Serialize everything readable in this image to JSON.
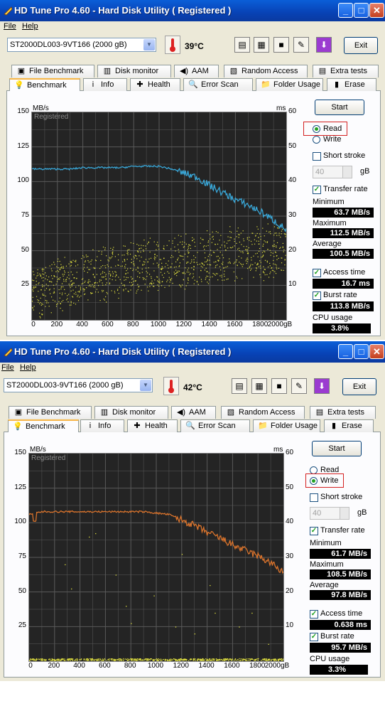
{
  "window_title": "HD Tune Pro 4.60 - Hard Disk Utility ( Registered )",
  "menu": {
    "file": "File",
    "help": "Help"
  },
  "toolbar": {
    "drive": "ST2000DL003-9VT166 (2000 gB)",
    "exit_label": "Exit"
  },
  "tabs_row1": [
    "File Benchmark",
    "Disk monitor",
    "AAM",
    "Random Access",
    "Extra tests"
  ],
  "tabs_row2": [
    "Benchmark",
    "Info",
    "Health",
    "Error Scan",
    "Folder Usage",
    "Erase"
  ],
  "graph": {
    "watermark": "Registered",
    "left_unit": "MB/s",
    "right_unit": "ms",
    "left_ticks": [
      "150",
      "125",
      "100",
      "75",
      "50",
      "25"
    ],
    "right_ticks": [
      "60",
      "50",
      "40",
      "30",
      "20",
      "10"
    ],
    "x_ticks": [
      "0",
      "200",
      "400",
      "600",
      "800",
      "1000",
      "1200",
      "1400",
      "1600",
      "1800",
      "2000gB"
    ]
  },
  "controls": {
    "start_label": "Start",
    "read_label": "Read",
    "write_label": "Write",
    "short_stroke_label": "Short stroke",
    "short_stroke_value": "40",
    "short_stroke_unit": "gB",
    "transfer_rate_label": "Transfer rate",
    "minimum_label": "Minimum",
    "maximum_label": "Maximum",
    "average_label": "Average",
    "access_time_label": "Access time",
    "burst_rate_label": "Burst rate",
    "cpu_usage_label": "CPU usage"
  },
  "colors": {
    "read_line": "#39a7d8",
    "write_line": "#d9732c",
    "access_dots": "#e0e040",
    "graph_bg": "#242424",
    "grid": "#5a5a5a"
  },
  "panels": [
    {
      "mode": "Read",
      "temperature": "39°C",
      "minimum": "63.7 MB/s",
      "maximum": "112.5 MB/s",
      "average": "100.5 MB/s",
      "access_time": "16.7 ms",
      "burst_rate": "113.8 MB/s",
      "cpu_usage": "3.8%",
      "chart_data": {
        "type": "line",
        "x": [
          0,
          100,
          200,
          300,
          400,
          500,
          600,
          700,
          800,
          900,
          1000,
          1100,
          1200,
          1300,
          1400,
          1500,
          1600,
          1700,
          1800,
          1900,
          2000
        ],
        "series": [
          {
            "values": [
              109,
              109,
              109,
              109,
              110,
              110,
              110,
              110,
              111,
              111,
              111,
              109,
              106,
              103,
              97,
              92,
              87,
              83,
              78,
              72,
              65
            ]
          }
        ],
        "access_time_range_ms": [
          6,
          26
        ],
        "ylim": [
          0,
          150
        ],
        "y2lim": [
          0,
          60
        ]
      }
    },
    {
      "mode": "Write",
      "temperature": "42°C",
      "minimum": "61.7 MB/s",
      "maximum": "108.5 MB/s",
      "average": "97.8 MB/s",
      "access_time": "0.638 ms",
      "burst_rate": "95.7 MB/s",
      "cpu_usage": "3.3%",
      "chart_data": {
        "type": "line",
        "x": [
          0,
          100,
          200,
          300,
          400,
          500,
          600,
          700,
          800,
          900,
          1000,
          1100,
          1200,
          1300,
          1400,
          1500,
          1600,
          1700,
          1800,
          1900,
          2000
        ],
        "series": [
          {
            "values": [
              106,
              108,
              108,
              108,
              108,
              108,
              108,
              108,
              108,
              108,
              107,
              106,
              102,
              98,
              93,
              89,
              84,
              80,
              76,
              71,
              64
            ]
          }
        ],
        "access_time_range_ms": [
          0,
          1
        ],
        "ylim": [
          0,
          150
        ],
        "y2lim": [
          0,
          60
        ]
      }
    }
  ]
}
